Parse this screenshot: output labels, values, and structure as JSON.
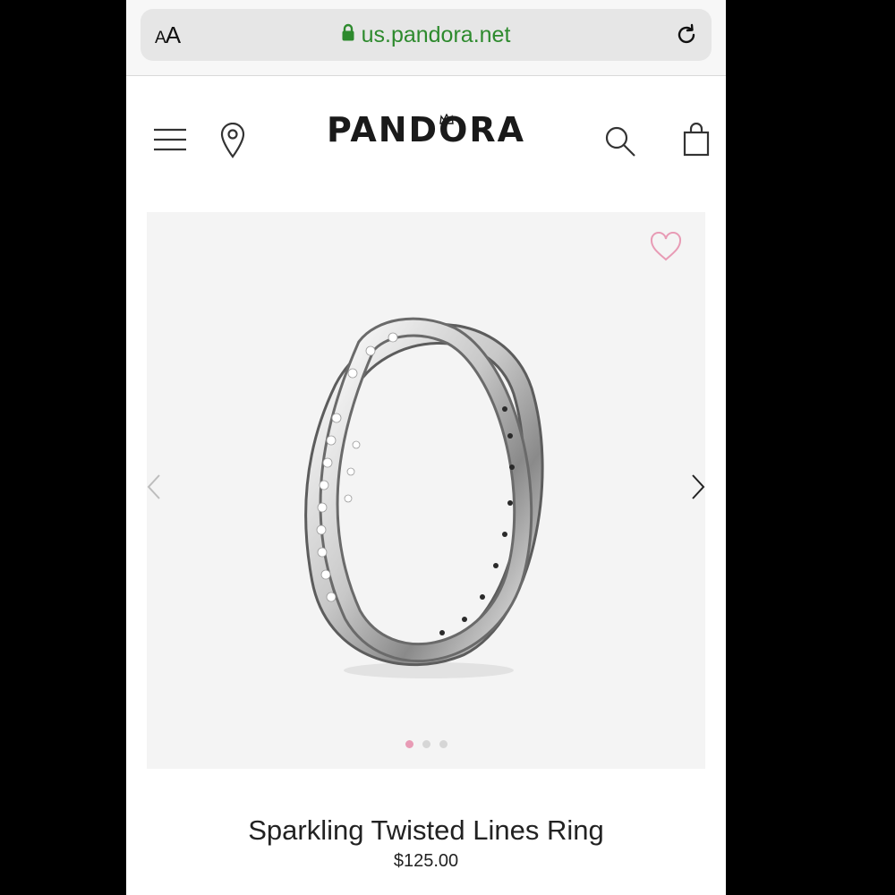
{
  "browser": {
    "text_size_button": {
      "small": "A",
      "large": "A"
    },
    "url": "us.pandora.net",
    "icons": {
      "lock": "lock-icon",
      "reload": "reload-icon"
    },
    "url_color": "#2d8a2d"
  },
  "header": {
    "logo": "PANDORA",
    "icons": [
      "menu-icon",
      "location-icon",
      "search-icon",
      "shopping-bag-icon"
    ]
  },
  "gallery": {
    "image": "sparkling-twisted-lines-ring",
    "slides": 3,
    "active_slide": 1,
    "icons": [
      "heart-icon",
      "chevron-left-icon",
      "chevron-right-icon"
    ],
    "wishlist_color": "#e89bb5"
  },
  "product": {
    "title": "Sparkling Twisted Lines Ring",
    "price": "$125.00"
  }
}
